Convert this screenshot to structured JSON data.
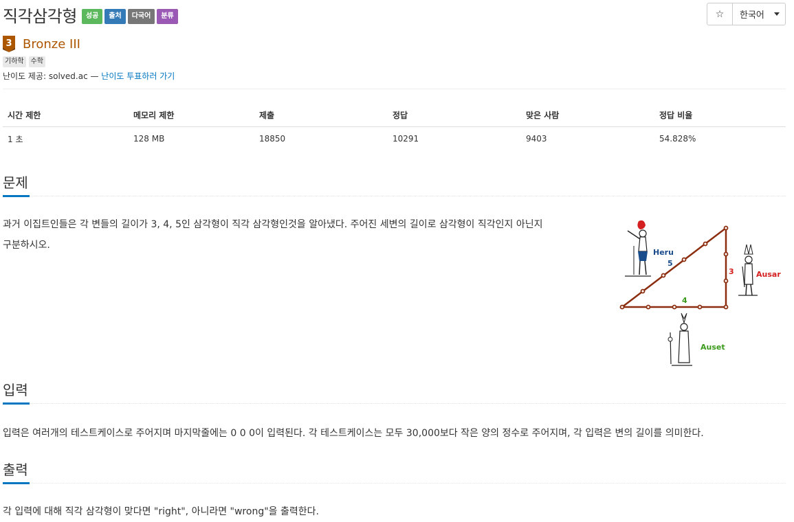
{
  "problem": {
    "title": "직각삼각형",
    "labels": [
      "성공",
      "출처",
      "다국어",
      "분류"
    ],
    "tier": "Bronze III",
    "tier_number": "3",
    "tags": [
      "기하학",
      "수학"
    ],
    "source_prefix": "난이도 제공: solved.ac — ",
    "vote_link": "난이도 투표하러 가기"
  },
  "toolbar": {
    "star": "☆",
    "language": "한국어"
  },
  "info_table": {
    "headers": [
      "시간 제한",
      "메모리 제한",
      "제출",
      "정답",
      "맞은 사람",
      "정답 비율"
    ],
    "values": [
      "1 초",
      "128 MB",
      "18850",
      "10291",
      "9403",
      "54.828%"
    ]
  },
  "sections": {
    "description": {
      "heading": "문제",
      "lines": [
        "과거 이집트인들은 각 변들의 길이가 3, 4, 5인 삼각형이 직각 삼각형인것을 알아냈다. 주어진 세변의 길이로 삼각형이 직각인지 아닌지",
        "구분하시오."
      ]
    },
    "input": {
      "heading": "입력",
      "text": "입력은 여러개의 테스트케이스로 주어지며 마지막줄에는 0 0 0이 입력된다. 각 테스트케이스는 모두 30,000보다 작은 양의 정수로 주어지며, 각 입력은 변의 길이를 의미한다."
    },
    "output": {
      "heading": "출력",
      "text": "각 입력에 대해 직각 삼각형이 맞다면 \"right\", 아니라면 \"wrong\"을 출력한다."
    }
  },
  "figure": {
    "labels": {
      "heru": "Heru",
      "ausar": "Ausar",
      "auset": "Auset",
      "side_a": "3",
      "side_b": "4",
      "side_c": "5"
    },
    "colors": {
      "rope": "#8b2d0e",
      "heru": "#1a4c8b",
      "ausar": "#d42020",
      "auset": "#3a9a1a"
    }
  }
}
